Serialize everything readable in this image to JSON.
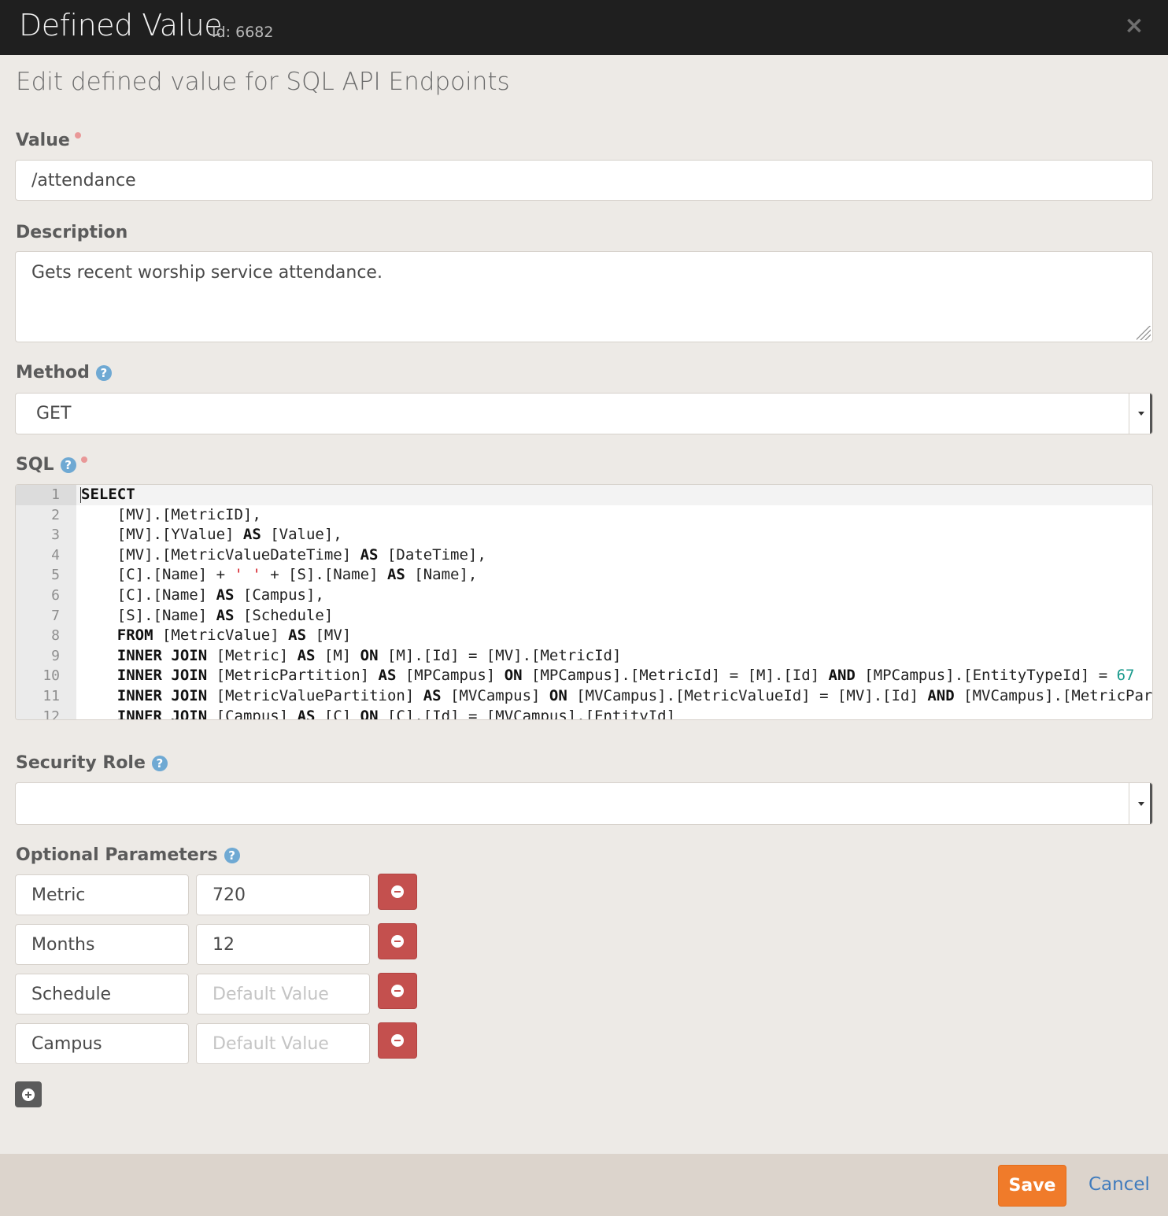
{
  "header": {
    "title": "Defined Value",
    "id_label": "Id: 6682",
    "close_glyph": "×"
  },
  "subtitle": "Edit defined value for SQL API Endpoints",
  "fields": {
    "value": {
      "label": "Value",
      "value": "/attendance"
    },
    "description": {
      "label": "Description",
      "value": "Gets recent worship service attendance."
    },
    "method": {
      "label": "Method",
      "selected": "GET"
    },
    "sql": {
      "label": "SQL"
    },
    "security_role": {
      "label": "Security Role",
      "selected": ""
    },
    "optional_parameters": {
      "label": "Optional Parameters",
      "rows": [
        {
          "key": "Metric",
          "value": "720",
          "placeholder": "Default Value"
        },
        {
          "key": "Months",
          "value": "12",
          "placeholder": "Default Value"
        },
        {
          "key": "Schedule",
          "value": "",
          "placeholder": "Default Value"
        },
        {
          "key": "Campus",
          "value": "",
          "placeholder": "Default Value"
        }
      ]
    }
  },
  "help_glyph": "?",
  "sql_lines": [
    "SELECT",
    "    [MV].[MetricID],",
    "    [MV].[YValue] AS [Value],",
    "    [MV].[MetricValueDateTime] AS [DateTime],",
    "    [C].[Name] + ' ' + [S].[Name] AS [Name],",
    "    [C].[Name] AS [Campus],",
    "    [S].[Name] AS [Schedule]",
    "    FROM [MetricValue] AS [MV]",
    "    INNER JOIN [Metric] AS [M] ON [M].[Id] = [MV].[MetricId]",
    "    INNER JOIN [MetricPartition] AS [MPCampus] ON [MPCampus].[MetricId] = [M].[Id] AND [MPCampus].[EntityTypeId] = 67",
    "    INNER JOIN [MetricValuePartition] AS [MVCampus] ON [MVCampus].[MetricValueId] = [MV].[Id] AND [MVCampus].[MetricPart",
    "    INNER JOIN [Campus] AS [C] ON [C].[Id] = [MVCampus].[EntityId]"
  ],
  "footer": {
    "save_label": "Save",
    "cancel_label": "Cancel"
  },
  "colors": {
    "header_bg": "#1f1f1f",
    "page_bg": "#edeae6",
    "footer_bg": "#dcd4cc",
    "save_button": "#f07b2a",
    "remove_button": "#c4504e",
    "link": "#3f7bbd",
    "help_icon": "#6fa9d3",
    "required_dot": "#e99898"
  }
}
